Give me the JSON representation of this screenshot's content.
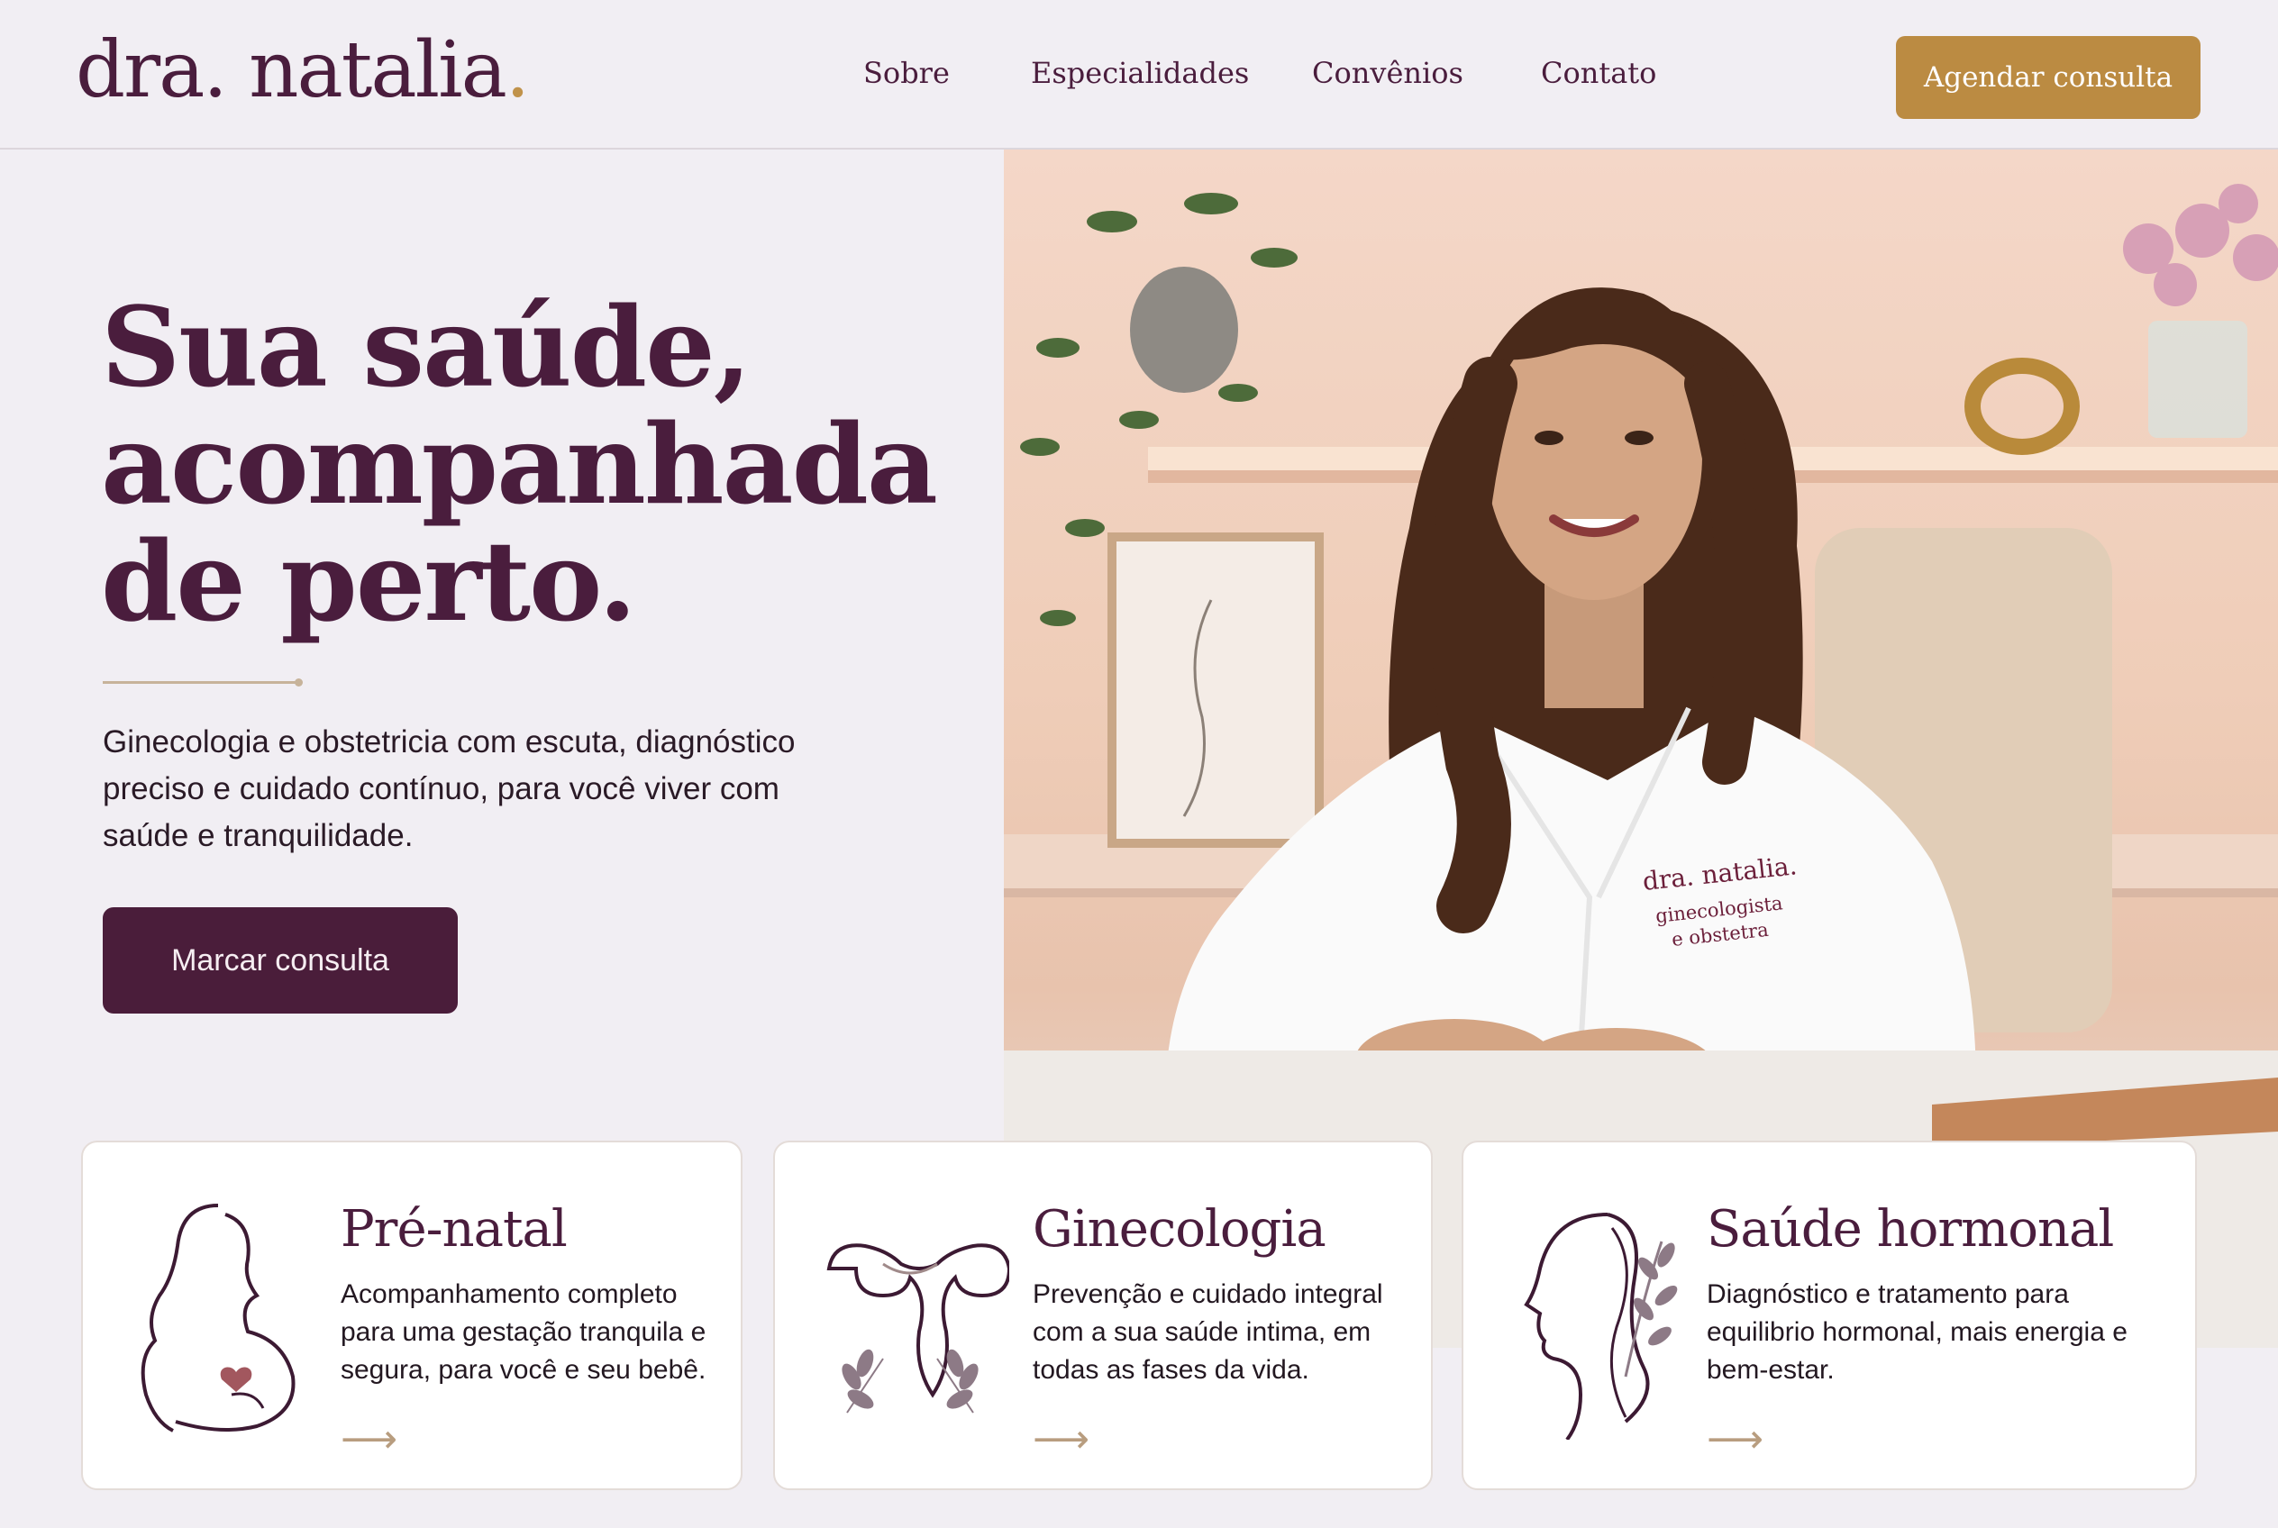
{
  "header": {
    "logo": "dra. natalia",
    "logo_dot": ".",
    "nav": [
      "Sobre",
      "Especialidades",
      "Convênios",
      "Contato"
    ],
    "cta": "Agendar consulta"
  },
  "hero": {
    "title_lines": [
      "Sua saúde,",
      "acompanhada",
      "de perto."
    ],
    "description": "Ginecologia e obstetricia com escuta, diagnóstico preciso e cuidado contínuo, para você viver com saúde e tranquilidade.",
    "button": "Marcar consulta"
  },
  "photo": {
    "coat_logo": "dra. natalia.",
    "coat_line1": "ginecologista",
    "coat_line2": "e obstetra"
  },
  "cards": [
    {
      "title": "Pré-natal",
      "text": "Acompanhamento completo para uma gestação tranquila e segura, para você e seu bebê.",
      "arrow": "⟶",
      "icon": "pregnant-woman-icon"
    },
    {
      "title": "Ginecologia",
      "text": "Prevenção e cuidado integral com a sua saúde intima, em todas as fases da vida.",
      "arrow": "⟶",
      "icon": "uterus-icon"
    },
    {
      "title": "Saúde hormonal",
      "text": "Diagnóstico e tratamento para equilibrio hormonal, mais energia e bem-estar.",
      "arrow": "⟶",
      "icon": "woman-profile-leaf-icon"
    }
  ],
  "colors": {
    "brand": "#4a1d3d",
    "accent": "#bb8b42",
    "background": "#f1eef3"
  }
}
